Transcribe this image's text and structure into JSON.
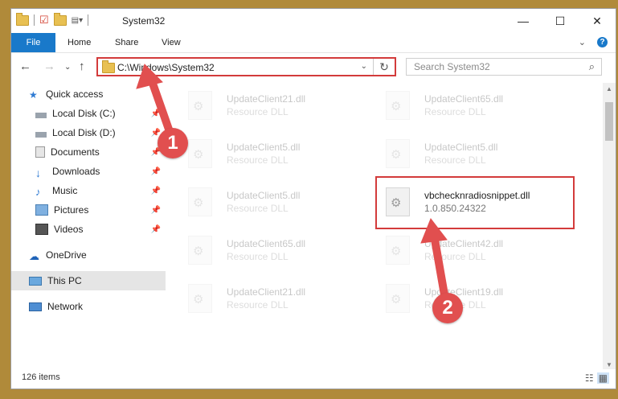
{
  "window": {
    "title": "System32"
  },
  "controls": {
    "minimize": "—",
    "maximize": "☐",
    "close": "✕"
  },
  "ribbon": {
    "tabs": [
      "File",
      "Home",
      "Share",
      "View"
    ]
  },
  "address": {
    "path": "C:\\Windows\\System32"
  },
  "search": {
    "placeholder": "Search System32"
  },
  "nav": {
    "items": [
      {
        "label": "Quick access",
        "icon": "star-icon",
        "pinned": false
      },
      {
        "label": "Local Disk (C:)",
        "icon": "drive-icon",
        "pinned": true
      },
      {
        "label": "Local Disk (D:)",
        "icon": "drive-icon",
        "pinned": true
      },
      {
        "label": "Documents",
        "icon": "documents-icon",
        "pinned": true
      },
      {
        "label": "Downloads",
        "icon": "download-icon",
        "pinned": true
      },
      {
        "label": "Music",
        "icon": "music-icon",
        "pinned": true
      },
      {
        "label": "Pictures",
        "icon": "pictures-icon",
        "pinned": true
      },
      {
        "label": "Videos",
        "icon": "videos-icon",
        "pinned": true
      },
      {
        "label": "OneDrive",
        "icon": "cloud-icon",
        "pinned": false
      },
      {
        "label": "This PC",
        "icon": "computer-icon",
        "pinned": false
      },
      {
        "label": "Network",
        "icon": "network-icon",
        "pinned": false
      }
    ]
  },
  "files": [
    {
      "name": "UpdateClient21.dll",
      "desc": "Resource DLL"
    },
    {
      "name": "UpdateClient65.dll",
      "desc": "Resource DLL"
    },
    {
      "name": "UpdateClient5.dll",
      "desc": "Resource DLL"
    },
    {
      "name": "UpdateClient5.dll",
      "desc": "Resource DLL"
    },
    {
      "name": "UpdateClient5.dll",
      "desc": "Resource DLL"
    },
    {
      "name": "vbchecknradiosnippet.dll",
      "desc": "1.0.850.24322"
    },
    {
      "name": "UpdateClient65.dll",
      "desc": "Resource DLL"
    },
    {
      "name": "UpdateClient42.dll",
      "desc": "Resource DLL"
    },
    {
      "name": "UpdateClient21.dll",
      "desc": "Resource DLL"
    },
    {
      "name": "UpdateClient19.dll",
      "desc": "Resource DLL"
    }
  ],
  "status": {
    "items": "126 items"
  },
  "annotations": {
    "step1": "1",
    "step2": "2",
    "color": "#e14f4f"
  }
}
